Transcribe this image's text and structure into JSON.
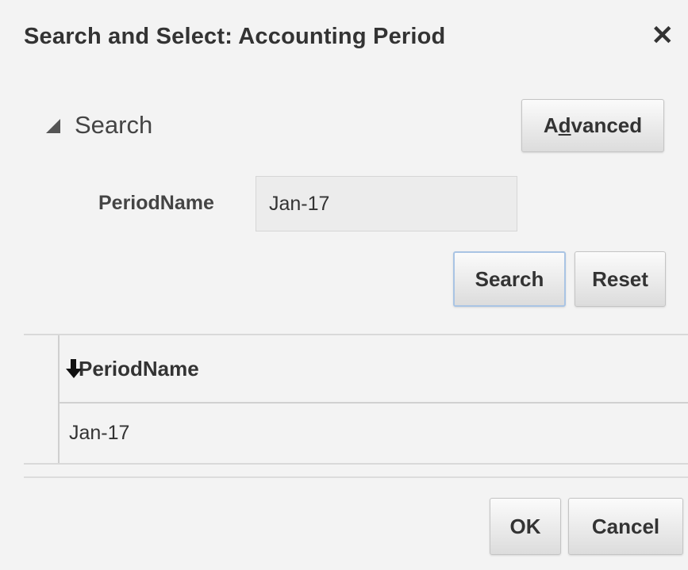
{
  "dialog": {
    "title": "Search and Select: Accounting Period",
    "close_glyph": "✕"
  },
  "search_panel": {
    "toggle_label": "Search",
    "advanced_label": "Advanced",
    "advanced_accesskey": "d"
  },
  "field": {
    "label": "PeriodName",
    "value": "Jan-17"
  },
  "actions": {
    "search_label": "Search",
    "reset_label": "Reset"
  },
  "results_table": {
    "columns": [
      {
        "label": "PeriodName",
        "sort": "descending"
      }
    ],
    "rows": [
      [
        "Jan-17"
      ]
    ]
  },
  "footer": {
    "ok_label": "OK",
    "cancel_label": "Cancel"
  },
  "colors": {
    "background": "#f3f3f3",
    "button_focus_border": "#a9c4e4",
    "text": "#333333"
  }
}
